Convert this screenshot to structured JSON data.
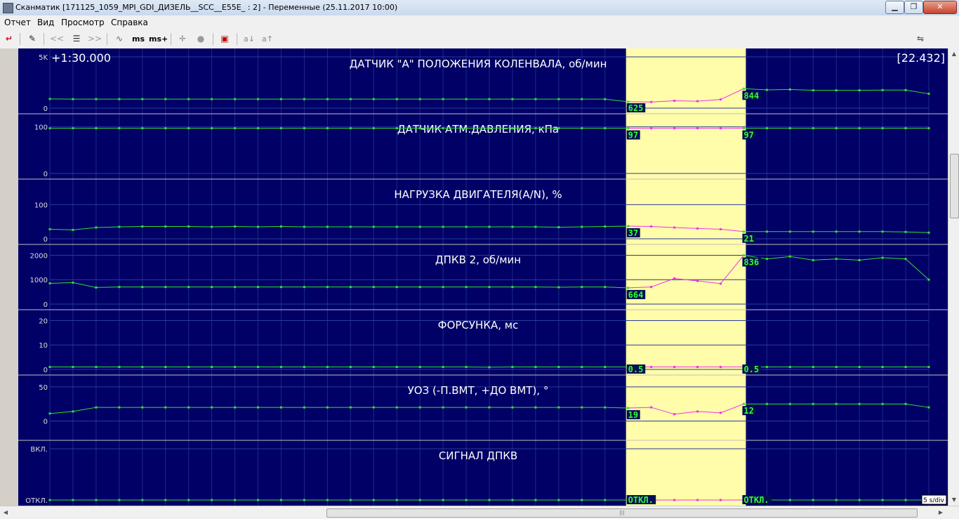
{
  "window": {
    "title": "Сканматик [171125_1059_MPI_GDI_ДИЗЕЛЬ__SCC__E55E_ : 2] - Переменные (25.11.2017  10:00)",
    "min_glyph": "▁",
    "max_glyph": "❐",
    "close_glyph": "✕"
  },
  "menu": [
    "Отчет",
    "Вид",
    "Просмотр",
    "Справка"
  ],
  "toolbar": {
    "ms_label": "ms",
    "ms_plus_label": "ms+",
    "a_down_label": "a↓",
    "a_up_label": "a↑",
    "prev_glyph": "<<",
    "next_glyph": ">>"
  },
  "colors": {
    "background": "#000066",
    "grid": "#1e2a88",
    "trace": "#33dd33",
    "trace_selected": "#ee33ee",
    "highlight": "#fffcaa",
    "separator": "#c0c0c0",
    "value_box": "#001050",
    "value_text": "#33ff33"
  },
  "chart_data": {
    "type": "line",
    "time_label": "+1:30.000",
    "cursor_value": "[22.432]",
    "scale_label": "5 s/div",
    "sample_count": 38,
    "highlight_range_samples": [
      25,
      30
    ],
    "panels": [
      {
        "title": "ДАТЧИК \"А\" ПОЛОЖЕНИЯ КОЛЕНВАЛА, об/мин",
        "ymin": 0,
        "ymax": 5000,
        "ticks": [
          {
            "v": 5000,
            "label": "5K"
          },
          {
            "v": 0,
            "label": "0"
          }
        ],
        "cursor_left": "625",
        "cursor_right": "844",
        "values": [
          900,
          880,
          880,
          880,
          880,
          880,
          880,
          880,
          880,
          880,
          880,
          880,
          880,
          880,
          880,
          880,
          880,
          880,
          880,
          880,
          880,
          880,
          880,
          880,
          880,
          625,
          600,
          720,
          680,
          844,
          1900,
          1780,
          1820,
          1740,
          1740,
          1740,
          1760,
          1760,
          1400
        ]
      },
      {
        "title": "ДАТЧИК АТМ.ДАВЛЕНИЯ, кПа",
        "ymin": 0,
        "ymax": 110,
        "ticks": [
          {
            "v": 100,
            "label": "100"
          },
          {
            "v": 0,
            "label": "0"
          }
        ],
        "cursor_left": "97",
        "cursor_right": "97",
        "values": [
          97,
          97,
          97,
          97,
          97,
          97,
          97,
          97,
          97,
          97,
          97,
          97,
          97,
          97,
          97,
          97,
          97,
          97,
          97,
          97,
          97,
          97,
          97,
          97,
          97,
          97,
          97,
          97,
          97,
          97,
          97,
          97,
          97,
          97,
          97,
          97,
          97,
          97,
          97
        ]
      },
      {
        "title": "НАГРУЗКА ДВИГАТЕЛЯ(A/N), %",
        "ymin": 0,
        "ymax": 150,
        "ticks": [
          {
            "v": 100,
            "label": "100"
          },
          {
            "v": 0,
            "label": "0"
          }
        ],
        "cursor_left": "37",
        "cursor_right": "21",
        "values": [
          28,
          26,
          33,
          35,
          36,
          36,
          36,
          35,
          36,
          35,
          36,
          35,
          35,
          35,
          35,
          35,
          35,
          35,
          35,
          35,
          35,
          35,
          34,
          35,
          36,
          37,
          36,
          33,
          30,
          28,
          21,
          21,
          21,
          21,
          21,
          21,
          21,
          20,
          18
        ]
      },
      {
        "title": "ДПКВ 2, об/мин",
        "ymin": 0,
        "ymax": 2100,
        "ticks": [
          {
            "v": 2000,
            "label": "2000"
          },
          {
            "v": 1000,
            "label": "1000"
          },
          {
            "v": 0,
            "label": "0"
          }
        ],
        "cursor_left": "664",
        "cursor_right": "836",
        "values": [
          850,
          880,
          680,
          700,
          700,
          700,
          700,
          700,
          700,
          700,
          700,
          700,
          700,
          700,
          700,
          700,
          700,
          700,
          700,
          700,
          700,
          700,
          690,
          700,
          700,
          664,
          700,
          1050,
          950,
          836,
          2000,
          1850,
          1950,
          1800,
          1850,
          1800,
          1900,
          1850,
          1000
        ]
      },
      {
        "title": "ФОРСУНКА, мс",
        "ymin": 0,
        "ymax": 21,
        "ticks": [
          {
            "v": 20,
            "label": "20"
          },
          {
            "v": 10,
            "label": "10"
          },
          {
            "v": 0,
            "label": "0"
          }
        ],
        "cursor_left": "0.5",
        "cursor_right": "0.5",
        "values": [
          1,
          1,
          1,
          1,
          1,
          1,
          1,
          1,
          1,
          1,
          1,
          1,
          1,
          1,
          1,
          1,
          1,
          1,
          1,
          0.9,
          1,
          1,
          1,
          1,
          1,
          1,
          1,
          1,
          1,
          1,
          1,
          1,
          1,
          1,
          1,
          1,
          1,
          1,
          1
        ]
      },
      {
        "title": "УОЗ (-П.ВМТ, +ДО ВМТ), °",
        "ymin": -20,
        "ymax": 55,
        "ticks": [
          {
            "v": 50,
            "label": "50"
          },
          {
            "v": 0,
            "label": "0"
          }
        ],
        "cursor_left": "19",
        "cursor_right": "12",
        "values": [
          11,
          14,
          20,
          20,
          20,
          20,
          20,
          20,
          20,
          20,
          20,
          20,
          20,
          20,
          20,
          20,
          20,
          20,
          20,
          20,
          20,
          20,
          20,
          20,
          20,
          19,
          20,
          10,
          14,
          12,
          25,
          25,
          25,
          25,
          25,
          25,
          25,
          25,
          20
        ]
      },
      {
        "title": "СИГНАЛ ДПКВ",
        "ymin": 0,
        "ymax": 1,
        "ticks": [
          {
            "v": 1,
            "label": "ВКЛ."
          },
          {
            "v": 0,
            "label": "ОТКЛ."
          }
        ],
        "cursor_left": "ОТКЛ.",
        "cursor_right": "ОТКЛ.",
        "values": [
          0,
          0,
          0,
          0,
          0,
          0,
          0,
          0,
          0,
          0,
          0,
          0,
          0,
          0,
          0,
          0,
          0,
          0,
          0,
          0,
          0,
          0,
          0,
          0,
          0,
          0,
          0,
          0,
          0,
          0,
          0,
          0,
          0,
          0,
          0,
          0,
          0,
          0,
          0
        ]
      }
    ]
  }
}
